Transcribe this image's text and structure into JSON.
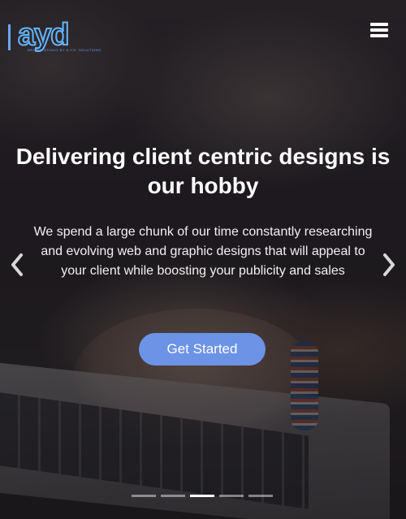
{
  "header": {
    "logo_text": "ayd",
    "logo_tagline": "DESIGN STUDIO BY A.Y.D. SOLUTIONS",
    "menu_icon": "hamburger-menu-icon"
  },
  "slide": {
    "headline": "Delivering client centric designs is our hobby",
    "description": "We spend a large chunk of our time constantly researching and evolving web and graphic designs that will appeal to your client while boosting your publicity and sales",
    "cta_label": "Get Started",
    "cta_color": "#6c93e6"
  },
  "carousel": {
    "prev_icon": "chevron-left-icon",
    "next_icon": "chevron-right-icon",
    "indicator_count": 5,
    "active_index": 2
  }
}
